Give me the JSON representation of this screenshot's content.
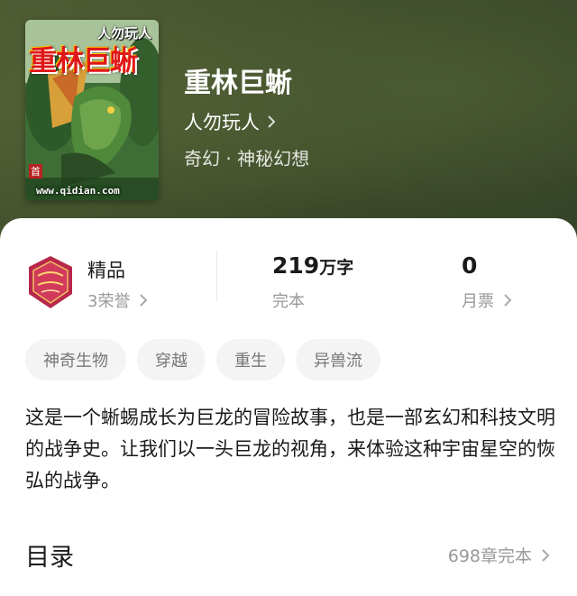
{
  "cover": {
    "author_text": "人勿玩人",
    "title_text": "重林巨蜥",
    "url_text": "www.qidian.com",
    "badge_text": "首"
  },
  "book": {
    "title": "重林巨蜥",
    "author": "人勿玩人",
    "genre": "奇幻 · 神秘幻想"
  },
  "stats": {
    "honor_title": "精品",
    "honor_sub": "3荣誉",
    "word_count": "219",
    "word_unit": "万字",
    "status": "完本",
    "monthly_tickets": "0",
    "monthly_tickets_label": "月票"
  },
  "tags": [
    "神奇生物",
    "穿越",
    "重生",
    "异兽流"
  ],
  "description": "这是一个蜥蜴成长为巨龙的冒险故事，也是一部玄幻和科技文明的战争史。让我们以一头巨龙的视角，来体验这种宇宙星空的恢弘的战争。",
  "toc": {
    "title": "目录",
    "info": "698章完本"
  }
}
